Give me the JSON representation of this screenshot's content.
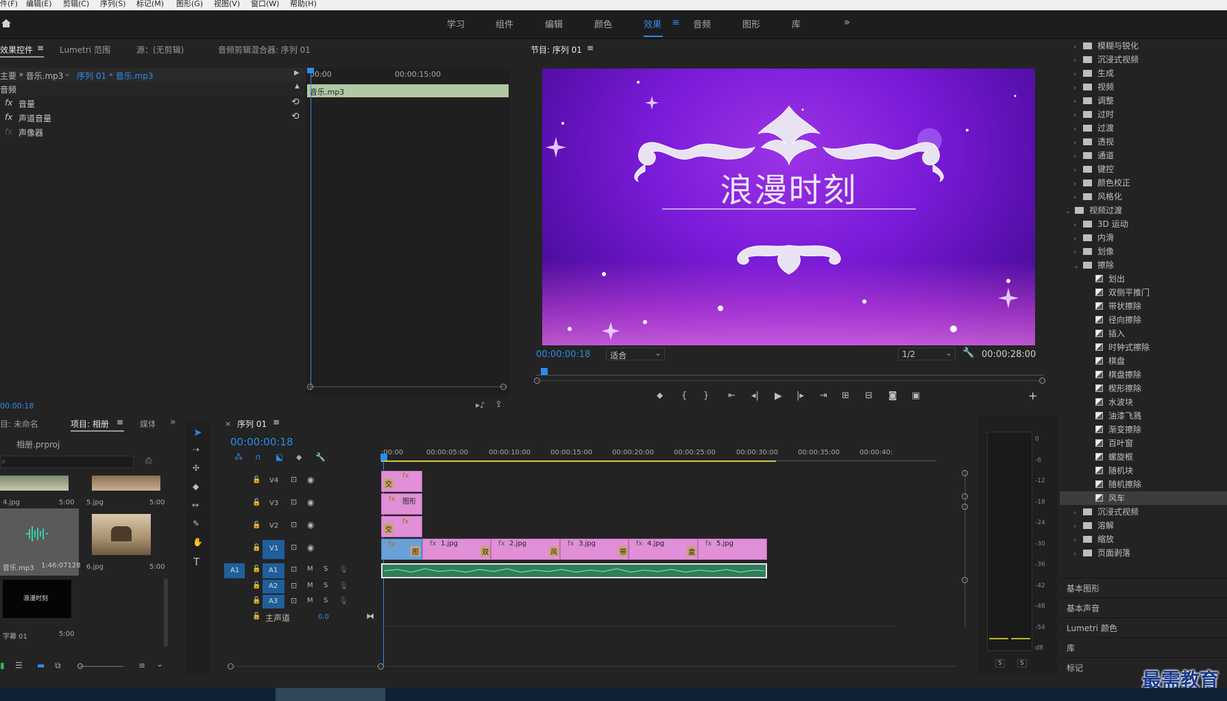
{
  "menu": [
    "件(F)",
    "编辑(E)",
    "剪辑(C)",
    "序列(S)",
    "标记(M)",
    "图形(G)",
    "视图(V)",
    "窗口(W)",
    "帮助(H)"
  ],
  "workspaces": [
    "学习",
    "组件",
    "编辑",
    "颜色",
    "效果",
    "音频",
    "图形",
    "库"
  ],
  "workspace_active": "效果",
  "effect_controls": {
    "tabs": [
      "效果控件",
      "Lumetri 范围",
      "源：(无剪辑)",
      "音频剪辑混合器: 序列 01"
    ],
    "source_label": "主要 * 音乐.mp3",
    "sequence_label": "序列 01 * 音乐.mp3",
    "tc_start": "00:00",
    "tc_mid": "00:00:15:00",
    "section": "音频",
    "clip_name": "音乐.mp3",
    "effects": [
      "音量",
      "声道音量",
      "声像器"
    ],
    "fx_label": "fx",
    "timecode": "00:00:18"
  },
  "program_monitor": {
    "title": "节目: 序列 01",
    "image_title": "浪漫时刻",
    "timecode": "00:00:00:18",
    "fit": "适合",
    "resolution": "1/2",
    "duration": "00:00:28:00"
  },
  "project": {
    "tabs": [
      "目: 未命名",
      "项目: 相册",
      "媒体"
    ],
    "project_file": "相册.prproj",
    "items": [
      {
        "name": "4.jpg",
        "dur": "5:00"
      },
      {
        "name": "5.jpg",
        "dur": "5:00"
      },
      {
        "name": "音乐.mp3",
        "dur": "1:46:07128"
      },
      {
        "name": "6.jpg",
        "dur": "5:00"
      },
      {
        "name": "字幕 01",
        "dur": "5:00",
        "thumb_text": "浪漫时刻"
      }
    ]
  },
  "timeline": {
    "title": "序列 01",
    "timecode": "00:00:00:18",
    "ruler": [
      ":00:00",
      "00:00:05:00",
      "00:00:10:00",
      "00:00:15:00",
      "00:00:20:00",
      "00:00:25:00",
      "00:00:30:00",
      "00:00:35:00",
      "00:00:40:"
    ],
    "video_tracks": [
      "V4",
      "V3",
      "V2",
      "V1"
    ],
    "audio_tracks": [
      "A1",
      "A2",
      "A3"
    ],
    "source_patch": "A1",
    "master_label": "主声道",
    "master_value": "0.0",
    "mute": "M",
    "solo": "S",
    "clips": [
      "1.jpg",
      "2.jpg",
      "3.jpg",
      "4.jpg",
      "5.jpg"
    ],
    "graphic_clip": "图形",
    "transition_labels": [
      "交",
      "交",
      "交",
      "交",
      "图",
      "双",
      "风",
      "带",
      "盒"
    ]
  },
  "meter": {
    "scale": [
      "0",
      "-6",
      "-12",
      "-18",
      "-24",
      "-30",
      "-36",
      "-42",
      "-48",
      "-54",
      "dB"
    ],
    "solo": [
      "S",
      "S"
    ]
  },
  "effects_panel": {
    "items": [
      {
        "type": "folder",
        "label": "模糊与锐化",
        "indent": 1,
        "open": false
      },
      {
        "type": "folder",
        "label": "沉浸式视频",
        "indent": 1,
        "open": false
      },
      {
        "type": "folder",
        "label": "生成",
        "indent": 1,
        "open": false
      },
      {
        "type": "folder",
        "label": "视频",
        "indent": 1,
        "open": false
      },
      {
        "type": "folder",
        "label": "调整",
        "indent": 1,
        "open": false
      },
      {
        "type": "folder",
        "label": "过时",
        "indent": 1,
        "open": false
      },
      {
        "type": "folder",
        "label": "过渡",
        "indent": 1,
        "open": false
      },
      {
        "type": "folder",
        "label": "透视",
        "indent": 1,
        "open": false
      },
      {
        "type": "folder",
        "label": "通道",
        "indent": 1,
        "open": false
      },
      {
        "type": "folder",
        "label": "键控",
        "indent": 1,
        "open": false
      },
      {
        "type": "folder",
        "label": "颜色校正",
        "indent": 1,
        "open": false
      },
      {
        "type": "folder",
        "label": "风格化",
        "indent": 1,
        "open": false
      },
      {
        "type": "folder",
        "label": "视频过渡",
        "indent": 0,
        "open": true
      },
      {
        "type": "folder",
        "label": "3D 运动",
        "indent": 1,
        "open": false
      },
      {
        "type": "folder",
        "label": "内滑",
        "indent": 1,
        "open": false
      },
      {
        "type": "folder",
        "label": "划像",
        "indent": 1,
        "open": false
      },
      {
        "type": "folder",
        "label": "擦除",
        "indent": 1,
        "open": true
      },
      {
        "type": "item",
        "label": "划出"
      },
      {
        "type": "item",
        "label": "双侧平推门"
      },
      {
        "type": "item",
        "label": "带状擦除"
      },
      {
        "type": "item",
        "label": "径向擦除"
      },
      {
        "type": "item",
        "label": "插入"
      },
      {
        "type": "item",
        "label": "时钟式擦除"
      },
      {
        "type": "item",
        "label": "棋盘"
      },
      {
        "type": "item",
        "label": "棋盘擦除"
      },
      {
        "type": "item",
        "label": "楔形擦除"
      },
      {
        "type": "item",
        "label": "水波块"
      },
      {
        "type": "item",
        "label": "油漆飞溅"
      },
      {
        "type": "item",
        "label": "渐变擦除"
      },
      {
        "type": "item",
        "label": "百叶窗"
      },
      {
        "type": "item",
        "label": "螺旋框"
      },
      {
        "type": "item",
        "label": "随机块"
      },
      {
        "type": "item",
        "label": "随机擦除"
      },
      {
        "type": "item",
        "label": "风车",
        "selected": true
      },
      {
        "type": "folder",
        "label": "沉浸式视频",
        "indent": 1,
        "open": false
      },
      {
        "type": "folder",
        "label": "溶解",
        "indent": 1,
        "open": false
      },
      {
        "type": "folder",
        "label": "缩放",
        "indent": 1,
        "open": false
      },
      {
        "type": "folder",
        "label": "页面剥落",
        "indent": 1,
        "open": false
      }
    ],
    "sections": [
      "基本图形",
      "基本声音",
      "Lumetri 颜色",
      "库",
      "标记"
    ]
  },
  "watermark": "最需教育"
}
